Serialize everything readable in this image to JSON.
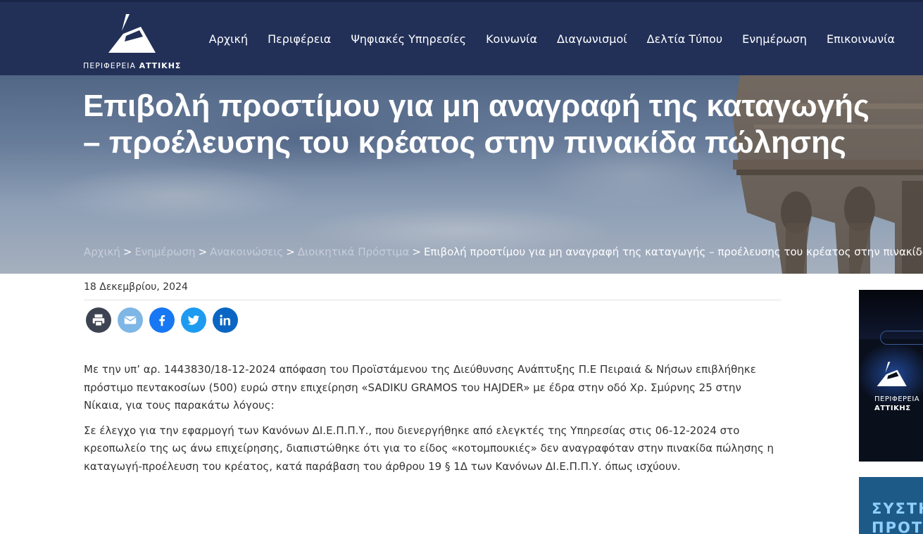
{
  "brand": {
    "logo_text_prefix": "ΠΕΡΙΦΕΡΕΙΑ",
    "logo_text_bold": "ΑΤΤΙΚΗΣ"
  },
  "nav": {
    "items": [
      "Αρχική",
      "Περιφέρεια",
      "Ψηφιακές Υπηρεσίες",
      "Κοινωνία",
      "Διαγωνισμοί",
      "Δελτία Τύπου",
      "Ενημέρωση",
      "Επικοινωνία"
    ]
  },
  "hero": {
    "title": "Επιβολή προστίμου για μη αναγραφή της καταγωγής – προέλευσης του κρέατος στην πινακίδα πώλησης"
  },
  "breadcrumb": {
    "items": [
      "Αρχική",
      "Ενημέρωση",
      "Ανακοινώσεις",
      "Διοικητικά Πρόστιμα"
    ],
    "separator": ">",
    "current": "Επιβολή προστίμου για μη αναγραφή της καταγωγής – προέλευσης του κρέατος στην πινακίδα πώλησης"
  },
  "article": {
    "date": "18 Δεκεμβρίου, 2024",
    "paragraphs": [
      "Με την υπ’ αρ. 1443830/18-12-2024 απόφαση του Προϊστάμενου της Διεύθυνσης Ανάπτυξης Π.Ε Πειραιά & Νήσων επιβλήθηκε πρόστιμο πεντακοσίων (500) ευρώ στην επιχείρηση «SADIKU GRAMOS του HAJDER» με έδρα στην οδό Χρ. Σμύρνης 25 στην Νίκαια,  για τους παρακάτω λόγους:",
      "Σε έλεγχο για την εφαρμογή των Κανόνων ΔΙ.Ε.Π.Π.Υ., που διενεργήθηκε από ελεγκτές της Υπηρεσίας στις 06-12-2024 στο κρεοπωλείο της ως άνω επιχείρησης, διαπιστώθηκε ότι για το είδος «κοτομπουκιές» δεν αναγραφόταν στην πινακίδα πώλησης η καταγωγή-προέλευση του κρέατος,  κατά παράβαση του άρθρου 19 § 1Δ των Κανόνων ΔΙ.Ε.Π.Π.Υ. όπως ισχύουν."
    ]
  },
  "share": {
    "icons": [
      "print-icon",
      "email-icon",
      "facebook-icon",
      "twitter-icon",
      "linkedin-icon"
    ],
    "colors": {
      "print": "#3d4451",
      "email": "#7eb6e6",
      "facebook": "#1877f2",
      "twitter": "#1d9bf0",
      "linkedin": "#0a66c2"
    }
  },
  "sidebar": {
    "banner1_line1": "ΠΕΡΙΦΕΡΕΙΑ",
    "banner1_line2": "ΑΤΤΙΚΗΣ",
    "banner2_line1": "ΣΥΣΤΗ",
    "banner2_line2": "ΠΡΟΤΕ"
  },
  "colors": {
    "header_bg": "#223058",
    "breadcrumb_link": "#c7cdd8",
    "text": "#333333"
  }
}
